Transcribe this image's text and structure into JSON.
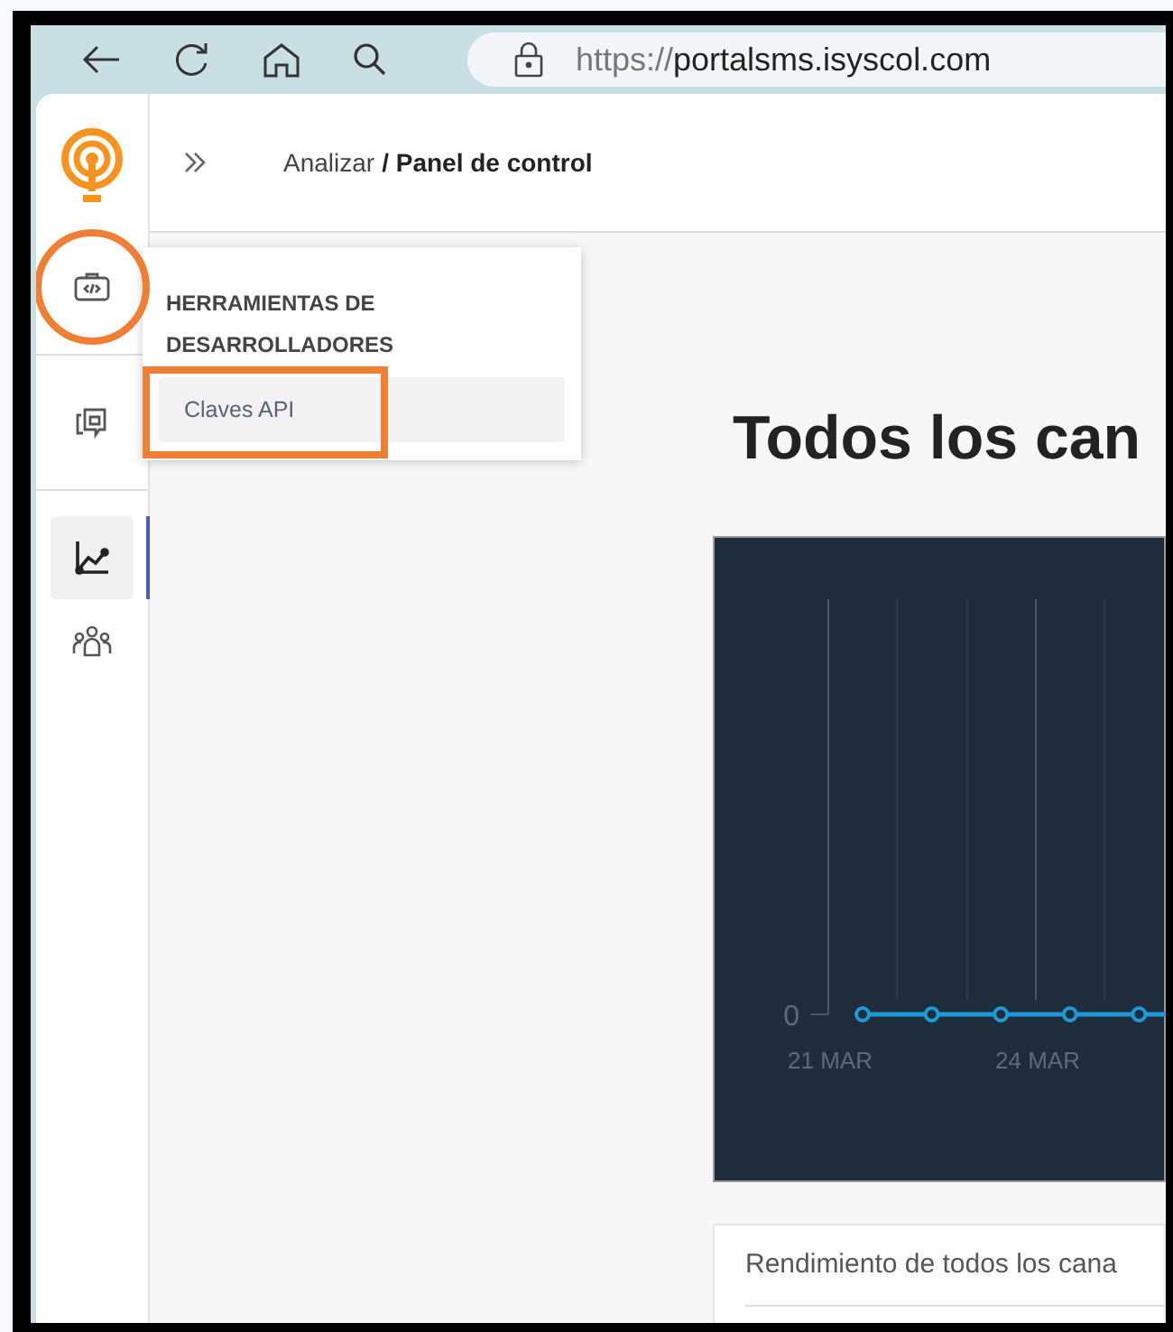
{
  "browser": {
    "url_scheme": "https://",
    "url_host": "portalsms.isyscol.com"
  },
  "sidebar": {
    "items": [
      {
        "selected": false
      },
      {
        "selected": false
      },
      {
        "selected": true
      },
      {
        "selected": false
      }
    ]
  },
  "breadcrumb": {
    "parent": "Analizar",
    "separator": "/",
    "current": "Panel de control"
  },
  "popup": {
    "title": "HERRAMIENTAS DE DESARROLLADORES",
    "items": [
      {
        "label": "Claves API",
        "selected": true
      }
    ]
  },
  "heading": "Todos los can",
  "chart": {
    "y_tick": "0",
    "x_labels": [
      "21 MAR",
      "24 MAR"
    ]
  },
  "card": {
    "title": "Rendimiento de todos los cana"
  }
}
